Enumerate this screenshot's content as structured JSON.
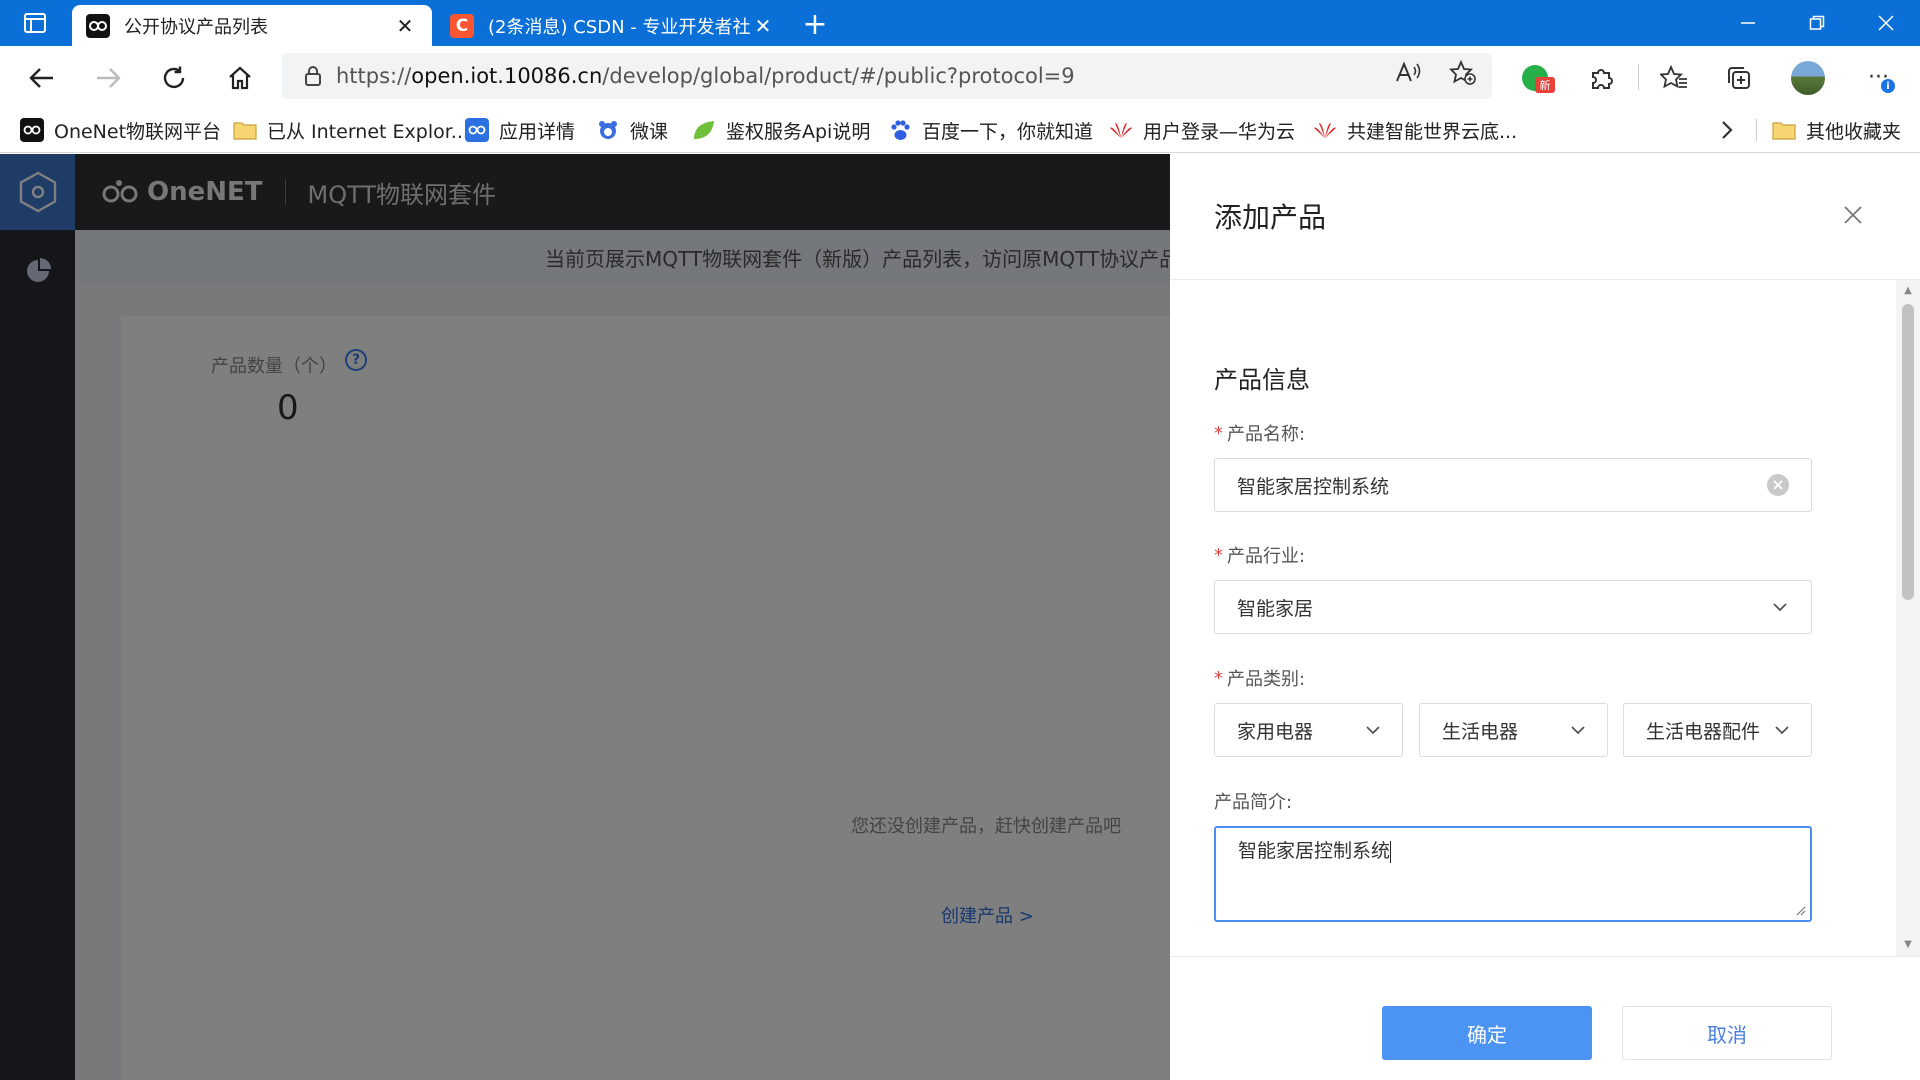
{
  "browser": {
    "tabs": [
      {
        "title": "公开协议产品列表",
        "close": "✕"
      },
      {
        "title": "(2条消息) CSDN - 专业开发者社区",
        "close": "✕"
      }
    ],
    "new_tab": "+",
    "url_prefix": "https://",
    "url_host": "open.iot.10086.cn",
    "url_path": "/develop/global/product/#/public?protocol=9",
    "badge_new": "新",
    "badge_info": "i"
  },
  "bookmarks": [
    {
      "label": "OneNet物联网平台",
      "icon": "onenet-icon"
    },
    {
      "label": "已从 Internet Explor...",
      "icon": "folder-icon"
    },
    {
      "label": "应用详情",
      "icon": "onenet-icon"
    },
    {
      "label": "微课",
      "icon": "bear-icon"
    },
    {
      "label": "鉴权服务Api说明",
      "icon": "leaf-icon"
    },
    {
      "label": "百度一下，你就知道",
      "icon": "baidu-icon"
    },
    {
      "label": "用户登录—华为云",
      "icon": "huawei-icon"
    },
    {
      "label": "共建智能世界云底...",
      "icon": "huawei-icon"
    },
    {
      "label": "其他收藏夹",
      "icon": "folder-icon"
    }
  ],
  "app": {
    "brand": "OneNET",
    "suite": "MQTT物联网套件",
    "notice": "当前页展示MQTT物联网套件（新版）产品列表，访问原MQTT协议产品",
    "stat_label": "产品数量（个）",
    "stat_help": "?",
    "stat_value": "0",
    "empty_text": "您还没创建产品，赶快创建产品吧",
    "create_link": "创建产品 >"
  },
  "drawer": {
    "title": "添加产品",
    "section_title": "产品信息",
    "required_mark": "*",
    "name_label": "产品名称:",
    "name_value": "智能家居控制系统",
    "industry_label": "产品行业:",
    "industry_value": "智能家居",
    "category_label": "产品类别:",
    "category_values": [
      "家用电器",
      "生活电器",
      "生活电器配件"
    ],
    "intro_label": "产品简介:",
    "intro_value": "智能家居控制系统",
    "confirm": "确定",
    "cancel": "取消"
  },
  "colors": {
    "browser_accent": "#0a6fd6",
    "primary_button": "#4b94f4",
    "link": "#2f6fdf",
    "required": "#e04444"
  }
}
